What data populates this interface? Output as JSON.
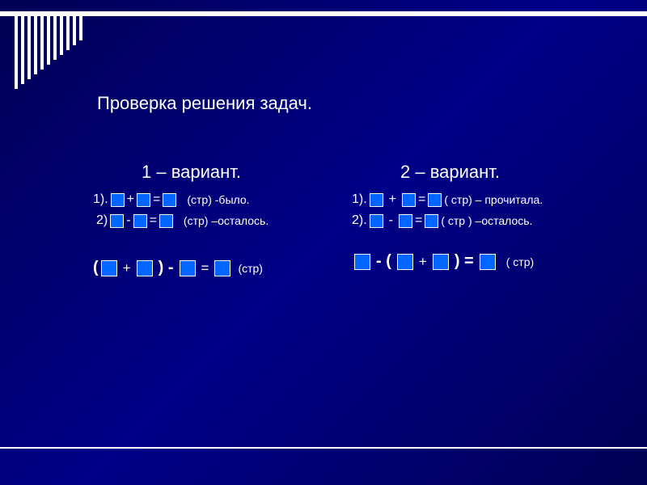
{
  "title": "Проверка решения задач.",
  "variant1": {
    "heading": "1 – вариант.",
    "line1_prefix": "1).",
    "line1_op1": "+",
    "line1_eq": "=",
    "line1_suffix": "(стр) -было.",
    "line2_prefix": "2)",
    "line2_op1": "-",
    "line2_eq": "=",
    "line2_suffix": "(стр) –осталось.",
    "expr_open": "(",
    "expr_op1": "+",
    "expr_close": ") -",
    "expr_eq": "=",
    "expr_suffix": "(стр)"
  },
  "variant2": {
    "heading": "2 – вариант.",
    "line1_prefix": "1).",
    "line1_op1": "+",
    "line1_eq": "=",
    "line1_suffix": "( стр) – прочитала.",
    "line2_prefix": "2).",
    "line2_op1": "-",
    "line2_eq": "=",
    "line2_suffix": "( стр ) –осталось.",
    "expr_pre": "- (",
    "expr_op1": "+",
    "expr_close": ") =",
    "expr_suffix": "( стр)"
  }
}
